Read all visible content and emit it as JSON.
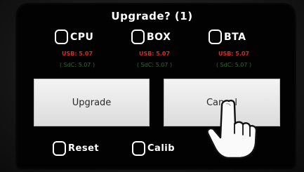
{
  "dialog": {
    "title": "Upgrade? (1)"
  },
  "modules": [
    {
      "label": "CPU",
      "usb": "USB: 5.07",
      "sdc": "( SdC: 5.07 )"
    },
    {
      "label": "BOX",
      "usb": "USB: 5.07",
      "sdc": "( SdC: 5.07 )"
    },
    {
      "label": "BTA",
      "usb": "USB: 5.07",
      "sdc": "( SdC: 5.07 )"
    }
  ],
  "buttons": {
    "upgrade": "Upgrade",
    "cancel": "Cancel"
  },
  "options": {
    "reset": "Reset",
    "calib": "Calib"
  },
  "colors": {
    "usb_version": "#d42a2a",
    "sdc_version": "#2e6a2e",
    "button_bg": "#ececec"
  },
  "icons": {
    "pointer": "pointing-hand-icon"
  }
}
